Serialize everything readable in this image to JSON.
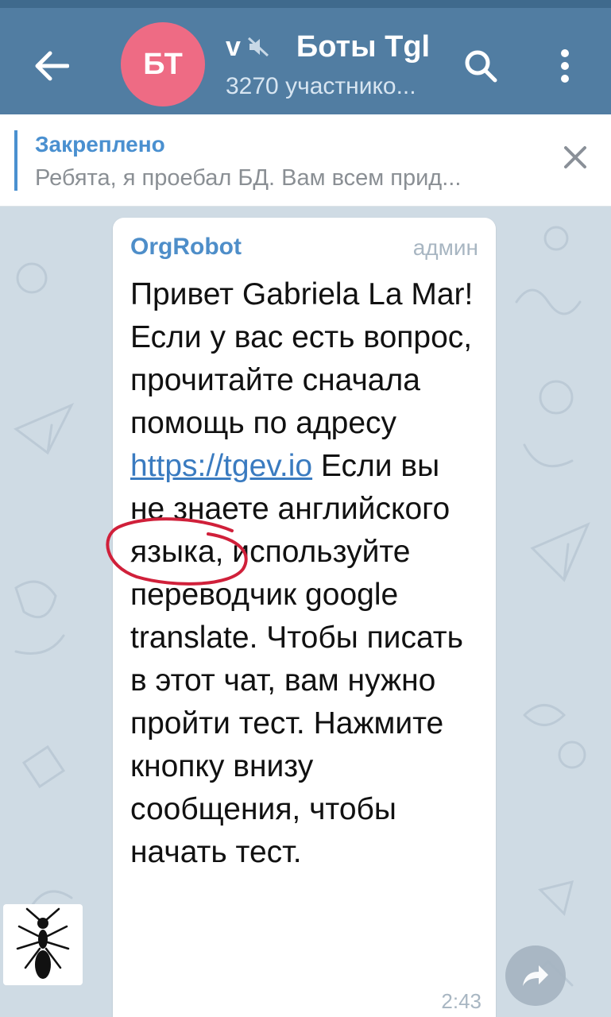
{
  "header": {
    "avatar_initials": "БТ",
    "title_prefix_clip": "v",
    "title": "Боты Tgl",
    "subtitle": "3270 участнико...",
    "colors": {
      "bar": "#517da2",
      "avatar": "#ee6b84"
    }
  },
  "pinned": {
    "label": "Закреплено",
    "text": "Ребята, я проебал БД. Вам всем прид..."
  },
  "message": {
    "sender": "OrgRobot",
    "badge": "админ",
    "text_before_link": "Привет Gabriela La Mar!\nЕсли у вас есть вопрос, прочитайте сначала помощь по адресу ",
    "link_text": "https://tgev.io",
    "text_after_link": " Если вы не знаете английского языка, используйте переводчик google translate. Чтобы писать в этот чат, вам нужно пройти тест. Нажмите кнопку внизу сообщения, чтобы начать тест.",
    "time": "2:43"
  },
  "icons": {
    "back": "arrow-left-icon",
    "mute": "mute-icon",
    "search": "search-icon",
    "more": "more-vertical-icon",
    "close": "close-icon",
    "share": "share-icon"
  }
}
